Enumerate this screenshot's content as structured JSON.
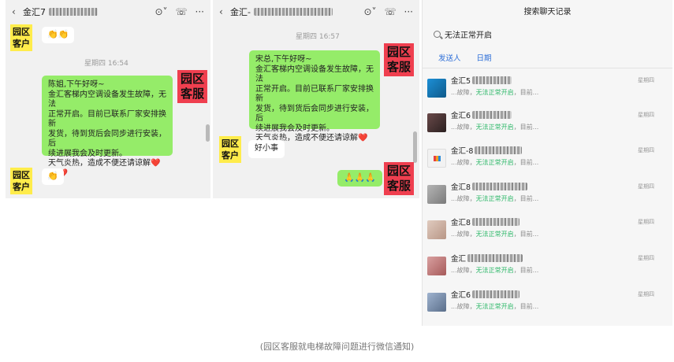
{
  "left_chat": {
    "title_prefix": "金汇7",
    "timestamp": "星期四 16:54",
    "customer_tag_top": "园区\n客户",
    "customer_emoji_top": "👏👏",
    "service_tag": "园区\n客服",
    "message_lines": [
      "陈姐,下午好呀~",
      "金汇客梯内空调设备发生故障，无法",
      "正常开启。目前已联系厂家安排换新",
      "发货，待到货后会同步进行安装，后",
      "续进展我会及时更新。",
      "天气炎热，造成不便还请谅解"
    ],
    "hearts": "❤️❤️❤️",
    "customer_tag_bottom": "园区\n客户",
    "customer_emoji_bottom": "👏"
  },
  "middle_chat": {
    "title_prefix": "金汇-",
    "timestamp": "星期四 16:57",
    "service_tag_top": "园区\n客服",
    "message_lines": [
      "宋总,下午好呀~",
      "金汇客梯内空调设备发生故障，无法",
      "正常开启。目前已联系厂家安排换新",
      "发货，待到货后会同步进行安装，后",
      "续进展我会及时更新。",
      "天气炎热，造成不便还请谅解"
    ],
    "hearts": "❤️❤️❤️",
    "customer_tag": "园区\n客户",
    "customer_reply": "好小事",
    "service_tag_bottom": "园区\n客服",
    "service_emoji": "🙏🙏🙏"
  },
  "search_panel": {
    "title": "搜索聊天记录",
    "query": "无法正常开启",
    "filters": [
      "发送人",
      "日期"
    ],
    "results": [
      {
        "name": "金汇5",
        "day": "星期四",
        "pre": "...故障，",
        "hl": "无法正常开启",
        "post": "，目前...",
        "color": "#1c8fd6"
      },
      {
        "name": "金汇6",
        "day": "星期四",
        "pre": "...故障，",
        "hl": "无法正常开启",
        "post": "，目前...",
        "color": "#4a3a3a"
      },
      {
        "name": "金汇-8",
        "day": "星期四",
        "pre": "...故障，",
        "hl": "无法正常开启",
        "post": "，目前...",
        "color": "#e8e8e8"
      },
      {
        "name": "金汇8",
        "day": "星期四",
        "pre": "...故障，",
        "hl": "无法正常开启",
        "post": "，目前...",
        "color": "#9a9a9a"
      },
      {
        "name": "金汇8",
        "day": "星期四",
        "pre": "...故障，",
        "hl": "无法正常开启",
        "post": "，目前...",
        "color": "#d9c2b5"
      },
      {
        "name": "金汇",
        "day": "星期四",
        "pre": "...故障，",
        "hl": "无法正常开启",
        "post": "，目前...",
        "color": "#c98b8b"
      },
      {
        "name": "金汇6",
        "day": "星期四",
        "pre": "...故障，",
        "hl": "无法正常开启",
        "post": "，目前...",
        "color": "#7d93b0"
      }
    ]
  },
  "caption": "(园区客服就电梯故障问题进行微信通知)"
}
